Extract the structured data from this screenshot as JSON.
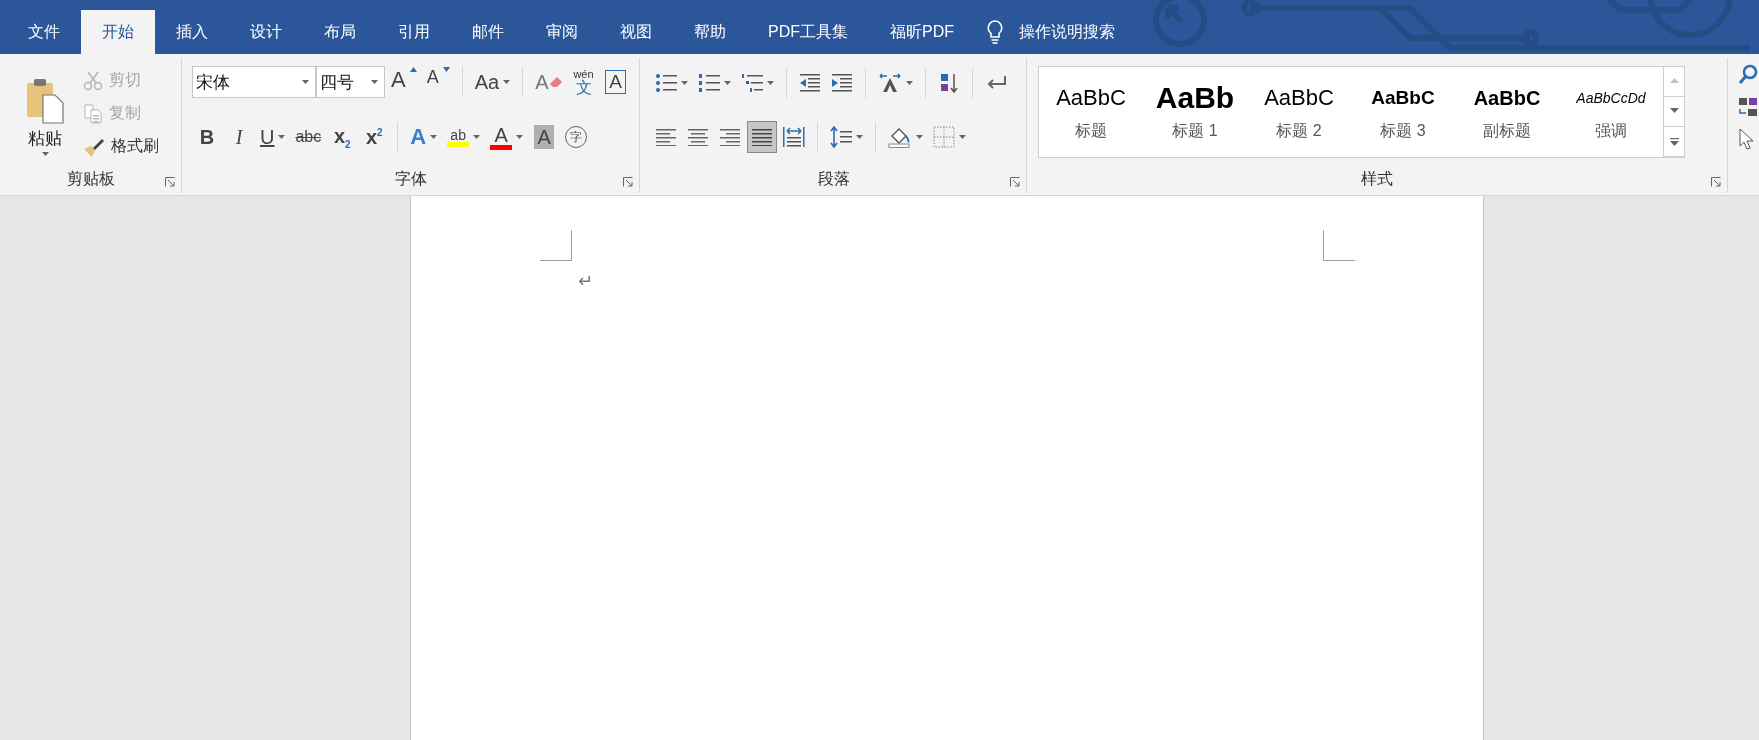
{
  "tabs": [
    {
      "label": "文件",
      "selected": false
    },
    {
      "label": "开始",
      "selected": true
    },
    {
      "label": "插入",
      "selected": false
    },
    {
      "label": "设计",
      "selected": false
    },
    {
      "label": "布局",
      "selected": false
    },
    {
      "label": "引用",
      "selected": false
    },
    {
      "label": "邮件",
      "selected": false
    },
    {
      "label": "审阅",
      "selected": false
    },
    {
      "label": "视图",
      "selected": false
    },
    {
      "label": "帮助",
      "selected": false
    },
    {
      "label": "PDF工具集",
      "selected": false
    },
    {
      "label": "福昕PDF",
      "selected": false
    }
  ],
  "tell_me": {
    "label": "操作说明搜索"
  },
  "clipboard": {
    "title": "剪贴板",
    "paste": {
      "label": "粘贴"
    },
    "actions": [
      {
        "kind": "cut",
        "label": "剪切",
        "disabled": true
      },
      {
        "kind": "copy",
        "label": "复制",
        "disabled": true
      },
      {
        "kind": "format_painter",
        "label": "格式刷",
        "disabled": false
      }
    ]
  },
  "font": {
    "title": "字体",
    "font_name": "宋体",
    "font_size": "四号",
    "row1": [
      [
        {
          "kind": "grow",
          "glyph": "A",
          "dropdown": false
        },
        {
          "kind": "shrink",
          "glyph": "A",
          "dropdown": false
        }
      ],
      [
        {
          "kind": "case",
          "glyph": "Aa",
          "dropdown": true
        }
      ],
      [
        {
          "kind": "clear",
          "glyph": "A",
          "dropdown": false
        },
        {
          "kind": "phonetic",
          "glyph": "wén",
          "sub": "文",
          "dropdown": false
        },
        {
          "kind": "border",
          "glyph": "A",
          "dropdown": false
        }
      ]
    ],
    "row2": [
      [
        {
          "kind": "bold",
          "glyph": "B",
          "dropdown": false
        },
        {
          "kind": "italic",
          "glyph": "I",
          "dropdown": false
        },
        {
          "kind": "underline",
          "glyph": "U",
          "dropdown": true
        },
        {
          "kind": "strike",
          "glyph": "abc",
          "dropdown": false
        },
        {
          "kind": "subscript",
          "glyph": "x$_{2}$",
          "dropdown": false
        },
        {
          "kind": "superscript",
          "glyph": "x$^{2}$",
          "dropdown": false
        }
      ],
      [
        {
          "kind": "effects",
          "glyph": "A",
          "dropdown": true
        },
        {
          "kind": "highlight",
          "glyph": "ab",
          "dropdown": true,
          "color": "#ffff00"
        },
        {
          "kind": "font_color",
          "glyph": "A",
          "dropdown": true,
          "color": "#ff0000"
        },
        {
          "kind": "shading",
          "glyph": "A",
          "dropdown": false
        },
        {
          "kind": "enclose",
          "glyph": "字",
          "dropdown": false
        }
      ]
    ]
  },
  "paragraph": {
    "title": "段落",
    "row1": [
      [
        {
          "kind": "bullets",
          "dropdown": true
        },
        {
          "kind": "numbering",
          "dropdown": true
        },
        {
          "kind": "multilevel",
          "dropdown": true
        }
      ],
      [
        {
          "kind": "decrease_indent",
          "dropdown": false
        },
        {
          "kind": "increase_indent",
          "dropdown": false
        }
      ],
      [
        {
          "kind": "asian_layout",
          "dropdown": true
        }
      ],
      [
        {
          "kind": "sort",
          "dropdown": false
        }
      ],
      [
        {
          "kind": "show_marks",
          "dropdown": false
        }
      ]
    ],
    "row2": [
      [
        {
          "kind": "align_left",
          "dropdown": false,
          "selected": false
        },
        {
          "kind": "align_center",
          "dropdown": false,
          "selected": false
        },
        {
          "kind": "align_right",
          "dropdown": false,
          "selected": false
        },
        {
          "kind": "justify",
          "dropdown": false,
          "selected": true
        },
        {
          "kind": "distributed",
          "dropdown": false,
          "selected": false
        }
      ],
      [
        {
          "kind": "line_spacing",
          "dropdown": true
        }
      ],
      [
        {
          "kind": "shading",
          "dropdown": true
        },
        {
          "kind": "borders",
          "dropdown": true
        }
      ]
    ]
  },
  "styles": {
    "title": "样式",
    "items": [
      {
        "kind": "title",
        "preview": "AaBbC",
        "label": "标题"
      },
      {
        "kind": "heading1",
        "preview": "AaBb",
        "label": "标题 1"
      },
      {
        "kind": "heading2",
        "preview": "AaBbC",
        "label": "标题 2"
      },
      {
        "kind": "heading3",
        "preview": "AaBbC",
        "label": "标题 3"
      },
      {
        "kind": "subtitle",
        "preview": "AaBbC",
        "label": "副标题"
      },
      {
        "kind": "emphasis",
        "preview": "AaBbCcDd",
        "label": "强调"
      }
    ]
  },
  "document": {
    "paragraph_mark": "↵"
  }
}
